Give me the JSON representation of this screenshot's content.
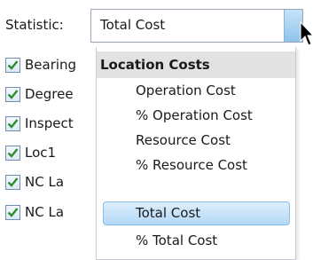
{
  "statistic": {
    "label": "Statistic:",
    "selected_value": "Total Cost"
  },
  "list": {
    "items": [
      {
        "label": "Bearing",
        "checked": true
      },
      {
        "label": "Degree",
        "checked": true
      },
      {
        "label": "Inspect",
        "checked": true
      },
      {
        "label": "Loc1",
        "checked": true
      },
      {
        "label": "NC La",
        "checked": true
      },
      {
        "label": "NC La",
        "checked": true
      }
    ]
  },
  "dropdown": {
    "group_header": "Location Costs",
    "options": [
      {
        "label": "Operation Cost",
        "selected": false
      },
      {
        "label": "% Operation Cost",
        "selected": false
      },
      {
        "label": "Resource Cost",
        "selected": false
      },
      {
        "label": "% Resource Cost",
        "selected": false
      },
      {
        "label": "Total Cost",
        "selected": true
      },
      {
        "label": "% Total Cost",
        "selected": false
      }
    ]
  },
  "colors": {
    "check": "#2e8b2e",
    "selection": "#b3d8f7",
    "header_bg": "#e2e2e2"
  }
}
